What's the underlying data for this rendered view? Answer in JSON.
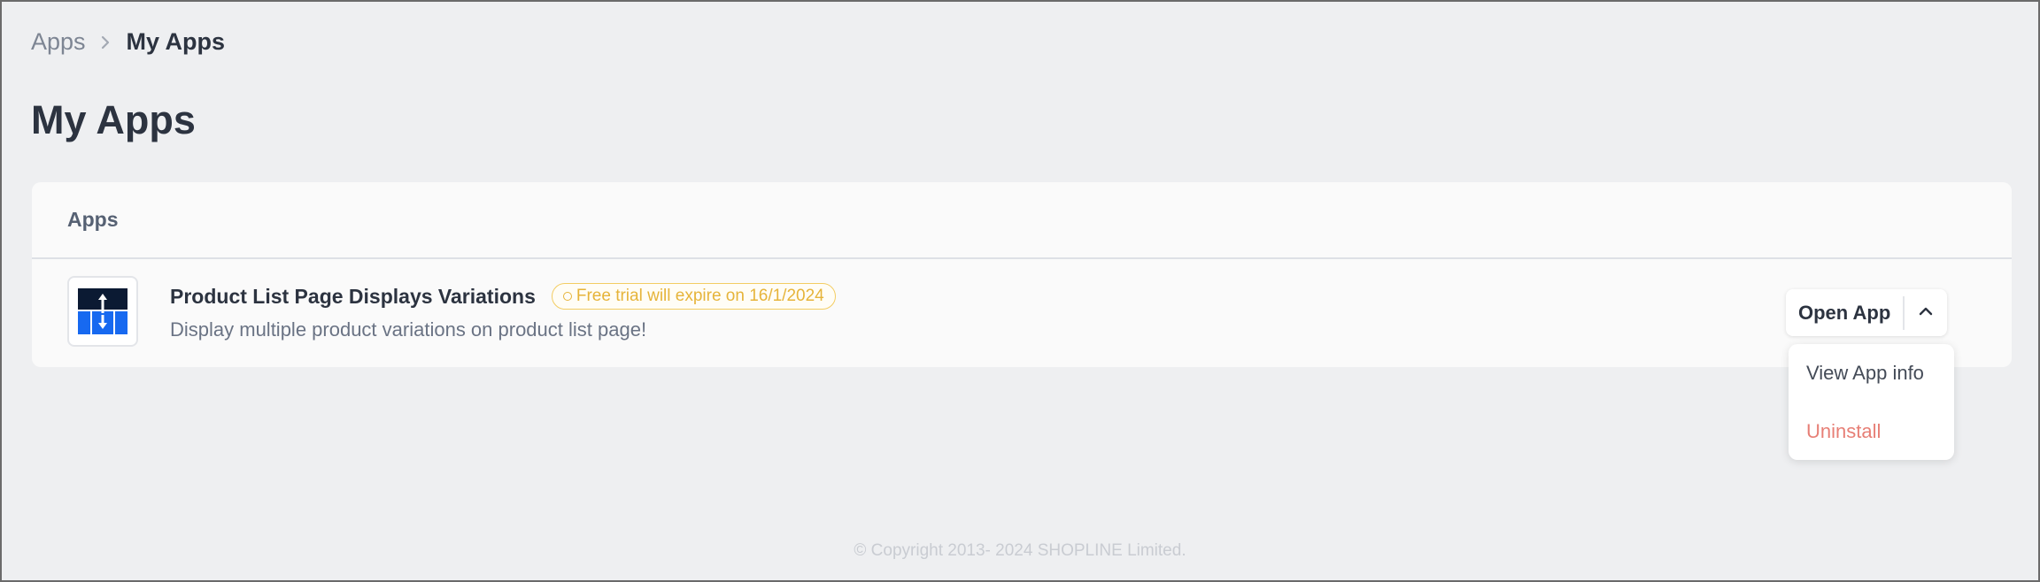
{
  "breadcrumb": {
    "parent": "Apps",
    "current": "My Apps"
  },
  "page": {
    "title": "My Apps"
  },
  "card": {
    "header": "Apps",
    "apps": [
      {
        "name": "Product List Page Displays Variations",
        "badge": "Free trial will expire on 16/1/2024",
        "description": "Display multiple product variations on product list page!",
        "open_label": "Open App",
        "menu": {
          "view_info": "View App info",
          "uninstall": "Uninstall"
        }
      }
    ]
  },
  "colors": {
    "background": "#eeeff1",
    "badge": "#e6b43a",
    "danger": "#e77f76",
    "logo_dark": "#0b1a33",
    "logo_blue": "#1769f0"
  },
  "footer": {
    "copyright": "© Copyright 2013- 2024 SHOPLINE Limited."
  }
}
